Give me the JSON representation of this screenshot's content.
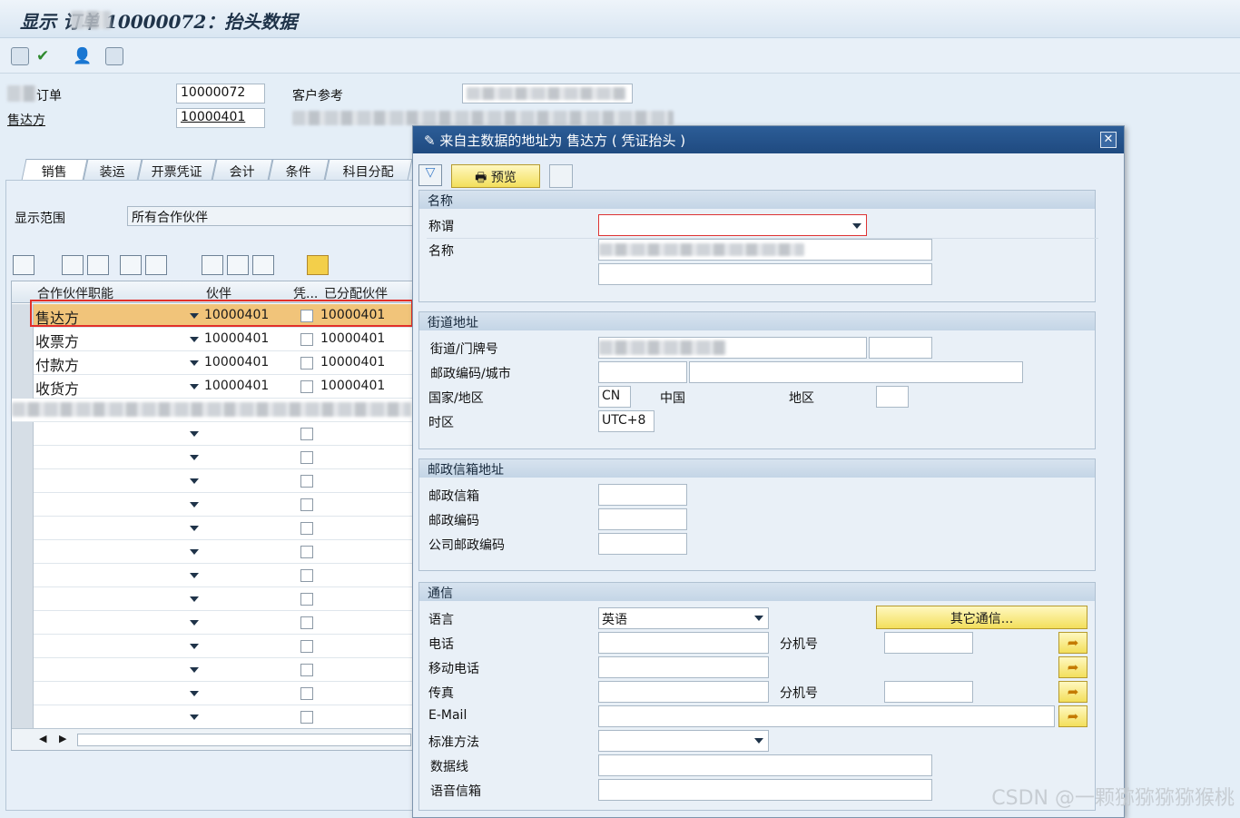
{
  "window": {
    "title": "显示      订单 10000072：抬头数据"
  },
  "header": {
    "order_label": "订单",
    "order_value": "10000072",
    "soldto_label": "售达方",
    "soldto_value": "10000401",
    "custref_label": "客户参考"
  },
  "tabs": [
    {
      "label": "销售"
    },
    {
      "label": "装运"
    },
    {
      "label": "开票凭证"
    },
    {
      "label": "会计"
    },
    {
      "label": "条件"
    },
    {
      "label": "科目分配"
    }
  ],
  "display_range": {
    "label": "显示范围",
    "value": "所有合作伙伴"
  },
  "grid": {
    "columns": [
      "合作伙伴职能",
      "伙伴",
      "凭...",
      "已分配伙伴"
    ],
    "rows": [
      {
        "function": "售达方",
        "partner": "10000401",
        "assigned": "10000401"
      },
      {
        "function": "收票方",
        "partner": "10000401",
        "assigned": "10000401"
      },
      {
        "function": "付款方",
        "partner": "10000401",
        "assigned": "10000401"
      },
      {
        "function": "收货方",
        "partner": "10000401",
        "assigned": "10000401"
      }
    ]
  },
  "dialog": {
    "title": "来自主数据的地址为 售达方 ( 凭证抬头 )",
    "preview_button": "预览",
    "name_group": {
      "title": "名称",
      "salutation_label": "称谓",
      "name_label": "名称"
    },
    "street_group": {
      "title": "街道地址",
      "street_label": "街道/门牌号",
      "postal_city_label": "邮政编码/城市",
      "country_label": "国家/地区",
      "country_code": "CN",
      "country_name": "中国",
      "region_label": "地区",
      "timezone_label": "时区",
      "timezone_value": "UTC+8"
    },
    "pobox_group": {
      "title": "邮政信箱地址",
      "pobox_label": "邮政信箱",
      "postal_label": "邮政编码",
      "company_postal_label": "公司邮政编码"
    },
    "comm_group": {
      "title": "通信",
      "language_label": "语言",
      "language_value": "英语",
      "other_comm_button": "其它通信...",
      "phone_label": "电话",
      "ext_label": "分机号",
      "mobile_label": "移动电话",
      "fax_label": "传真",
      "fax_ext_label": "分机号",
      "email_label": "E-Mail",
      "std_method_label": "标准方法",
      "data_line_label": "数据线",
      "voicemail_label": "语音信箱"
    }
  },
  "watermark": "CSDN @一颗猕猕猕猕猴桃"
}
